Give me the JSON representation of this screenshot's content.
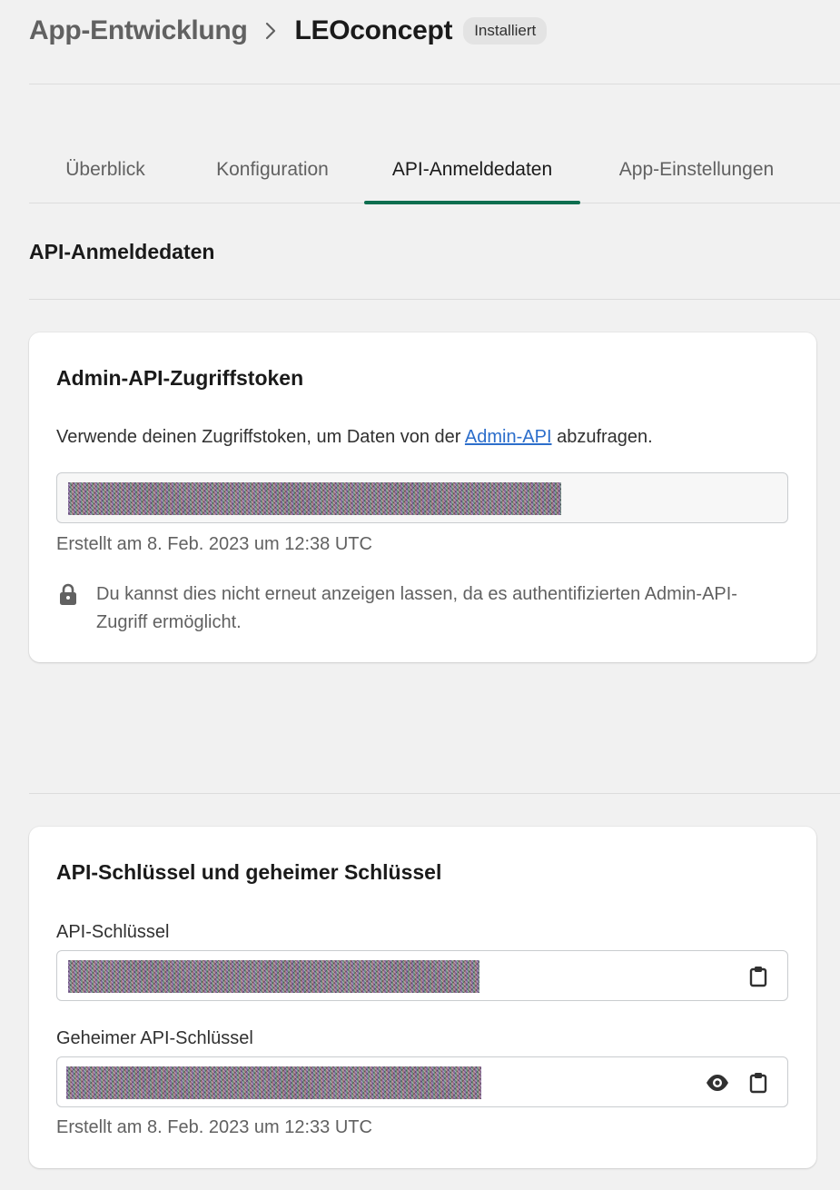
{
  "breadcrumb": {
    "parent": "App-Entwicklung",
    "current": "LEOconcept",
    "badge": "Installiert"
  },
  "tabs": [
    {
      "label": "Überblick",
      "active": false
    },
    {
      "label": "Konfiguration",
      "active": false
    },
    {
      "label": "API-Anmeldedaten",
      "active": true
    },
    {
      "label": "App-Einstellungen",
      "active": false
    }
  ],
  "section_title": "API-Anmeldedaten",
  "admin_token_card": {
    "title": "Admin-API-Zugriffstoken",
    "desc_prefix": "Verwende deinen Zugriffstoken, um Daten von der ",
    "desc_link": "Admin-API",
    "desc_suffix": " abzufragen.",
    "created": "Erstellt am 8. Feb. 2023 um 12:38 UTC",
    "note": "Du kannst dies nicht erneut anzeigen lassen, da es authentifizierten Admin-API-Zugriff ermöglicht.",
    "note_icon": "lock-icon"
  },
  "api_keys_card": {
    "title": "API-Schlüssel und geheimer Schlüssel",
    "api_key_label": "API-Schlüssel",
    "secret_label": "Geheimer API-Schlüssel",
    "created": "Erstellt am 8. Feb. 2023 um 12:33 UTC",
    "icons": [
      "clipboard-icon",
      "eye-icon"
    ]
  },
  "colors": {
    "active_tab_underline": "#0d6e4f",
    "link": "#2c6ecb",
    "badge_bg": "#e3e3e3"
  }
}
